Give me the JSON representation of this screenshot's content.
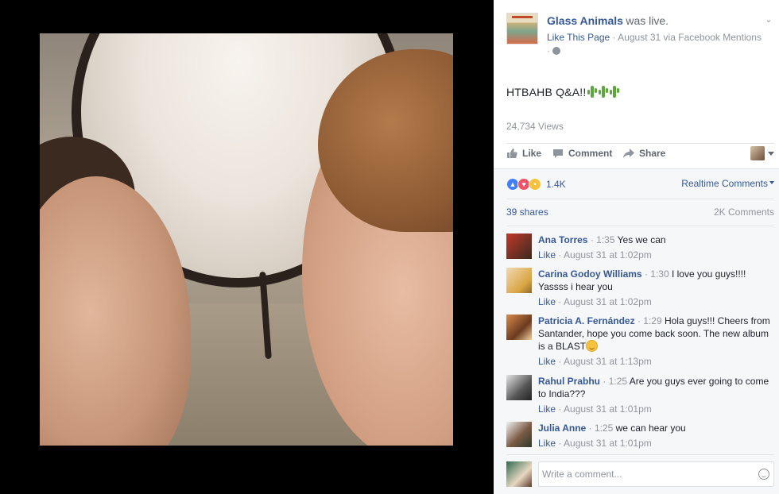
{
  "post": {
    "page_name": "Glass Animals",
    "was_live": "was live.",
    "like_page": "Like This Page",
    "meta_date": "· August 31 via Facebook Mentions",
    "meta_dot": "·",
    "text": "HTBAHB Q&A!!",
    "views": "24,734 Views"
  },
  "actions": {
    "like": "Like",
    "comment": "Comment",
    "share": "Share"
  },
  "reactions": {
    "count": "1.4K",
    "realtime_label": "Realtime Comments",
    "shares": "39 shares",
    "comments_count": "2K Comments"
  },
  "comments": [
    {
      "name": "Ana Torres",
      "time": "· 1:35",
      "text": "Yes we can",
      "like": "Like",
      "date": "· August 31 at 1:02pm"
    },
    {
      "name": "Carina Godoy Williams",
      "time": "· 1:30",
      "text": "I love you guys!!!! Yassss i hear you",
      "like": "Like",
      "date": "· August 31 at 1:02pm"
    },
    {
      "name": "Patricia A. Fernández",
      "time": "· 1:29",
      "text": "Hola guys!!! Cheers from Santander, hope you come back soon. The new album is a BLAST",
      "like": "Like",
      "date": "· August 31 at 1:13pm"
    },
    {
      "name": "Rahul Prabhu",
      "time": "· 1:25",
      "text": "Are you guys ever going to come to India???",
      "like": "Like",
      "date": "· August 31 at 1:01pm"
    },
    {
      "name": "Julia Anne",
      "time": "· 1:25",
      "text": "we can hear you",
      "like": "Like",
      "date": "· August 31 at 1:01pm"
    }
  ],
  "composer": {
    "placeholder": "Write a comment..."
  },
  "colors": {
    "link": "#365899",
    "muted": "#90949c",
    "panel_bg": "#f6f7f9"
  }
}
